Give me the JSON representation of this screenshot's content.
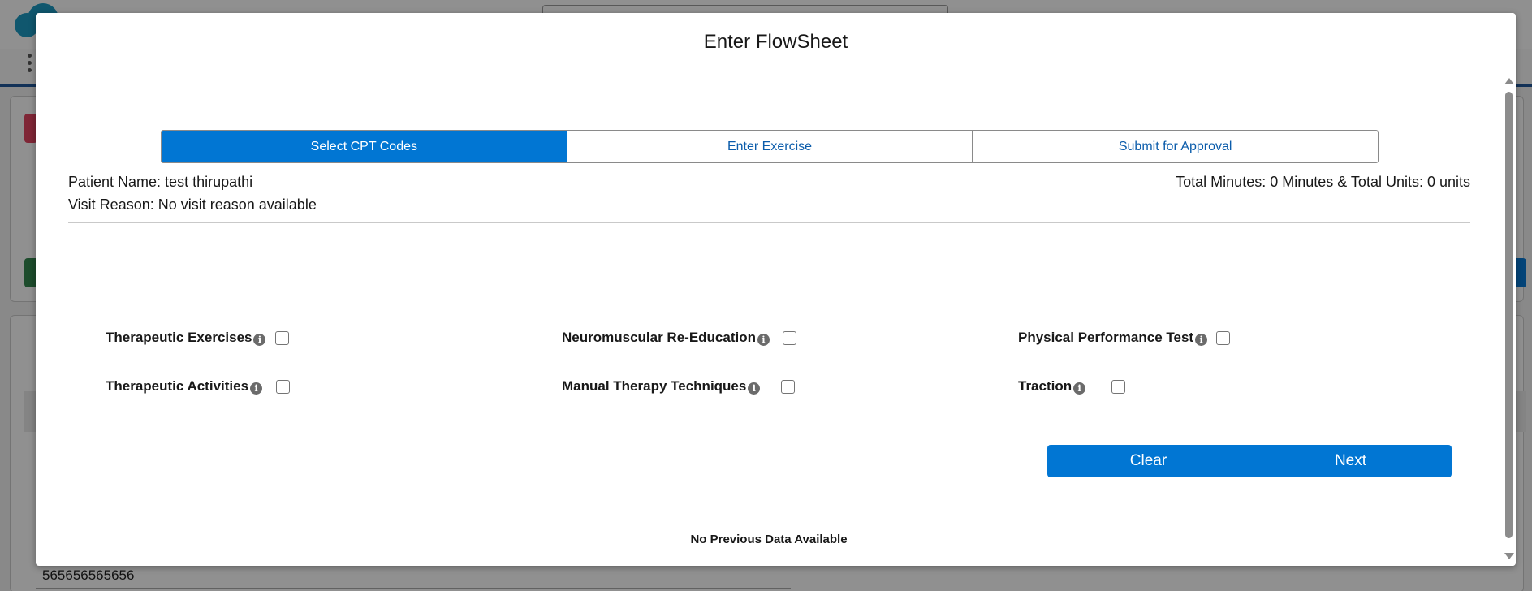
{
  "background": {
    "record_number": "565656565656"
  },
  "modal": {
    "title": "Enter FlowSheet",
    "steps": [
      {
        "label": "Select CPT Codes",
        "active": true
      },
      {
        "label": "Enter Exercise",
        "active": false
      },
      {
        "label": "Submit for Approval",
        "active": false
      }
    ],
    "patient": {
      "name_text": "Patient Name: test thirupathi",
      "visit_reason_text": "Visit Reason: No visit reason available",
      "totals_text": "Total Minutes: 0 Minutes & Total Units: 0 units"
    },
    "cpt_codes": [
      {
        "label": "Therapeutic Exercises",
        "checked": false
      },
      {
        "label": "Neuromuscular Re-Education",
        "checked": false
      },
      {
        "label": "Physical Performance Test",
        "checked": false
      },
      {
        "label": "Therapeutic Activities",
        "checked": false
      },
      {
        "label": "Manual Therapy Techniques",
        "checked": false
      },
      {
        "label": "Traction",
        "checked": false
      }
    ],
    "buttons": {
      "clear": "Clear",
      "next": "Next"
    },
    "no_data_text": "No Previous Data Available"
  },
  "icons": {
    "info": "info-icon",
    "scroll_up": "scroll-up-icon",
    "scroll_down": "scroll-down-icon"
  },
  "colors": {
    "brand_blue": "#0176d3",
    "step_text_blue": "#0b5cab",
    "info_icon_gray": "#6b6b6b"
  }
}
